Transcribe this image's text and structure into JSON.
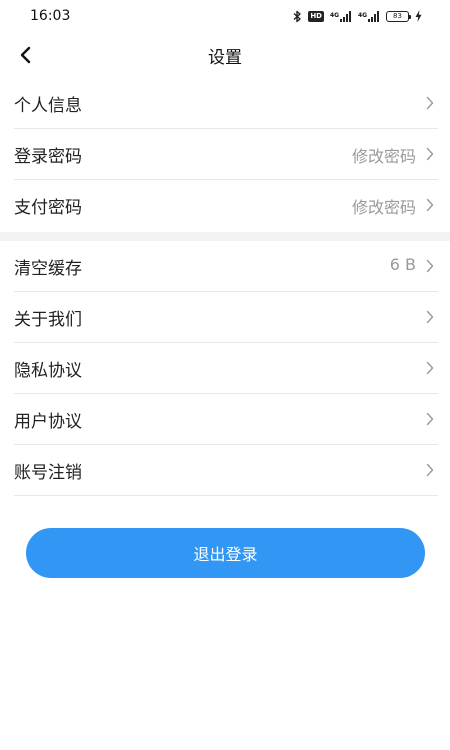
{
  "status_bar": {
    "time": "16:03",
    "hd": "HD",
    "signal_1": "4G",
    "signal_2": "4G",
    "battery": "83"
  },
  "nav": {
    "title": "设置"
  },
  "settings_group_1": [
    {
      "label": "个人信息",
      "value": ""
    },
    {
      "label": "登录密码",
      "value": "修改密码"
    },
    {
      "label": "支付密码",
      "value": "修改密码"
    }
  ],
  "settings_group_2": [
    {
      "label": "清空缓存",
      "value": "6 B"
    },
    {
      "label": "关于我们",
      "value": ""
    },
    {
      "label": "隐私协议",
      "value": ""
    },
    {
      "label": "用户协议",
      "value": ""
    },
    {
      "label": "账号注销",
      "value": ""
    }
  ],
  "logout": {
    "label": "退出登录"
  },
  "colors": {
    "accent": "#3296f5",
    "divider": "#e8e8e8",
    "section_gap": "#f3f3f5",
    "secondary_text": "#9a9a9a"
  },
  "icons": {
    "back": "chevron-left-icon",
    "row": "chevron-right-icon"
  }
}
